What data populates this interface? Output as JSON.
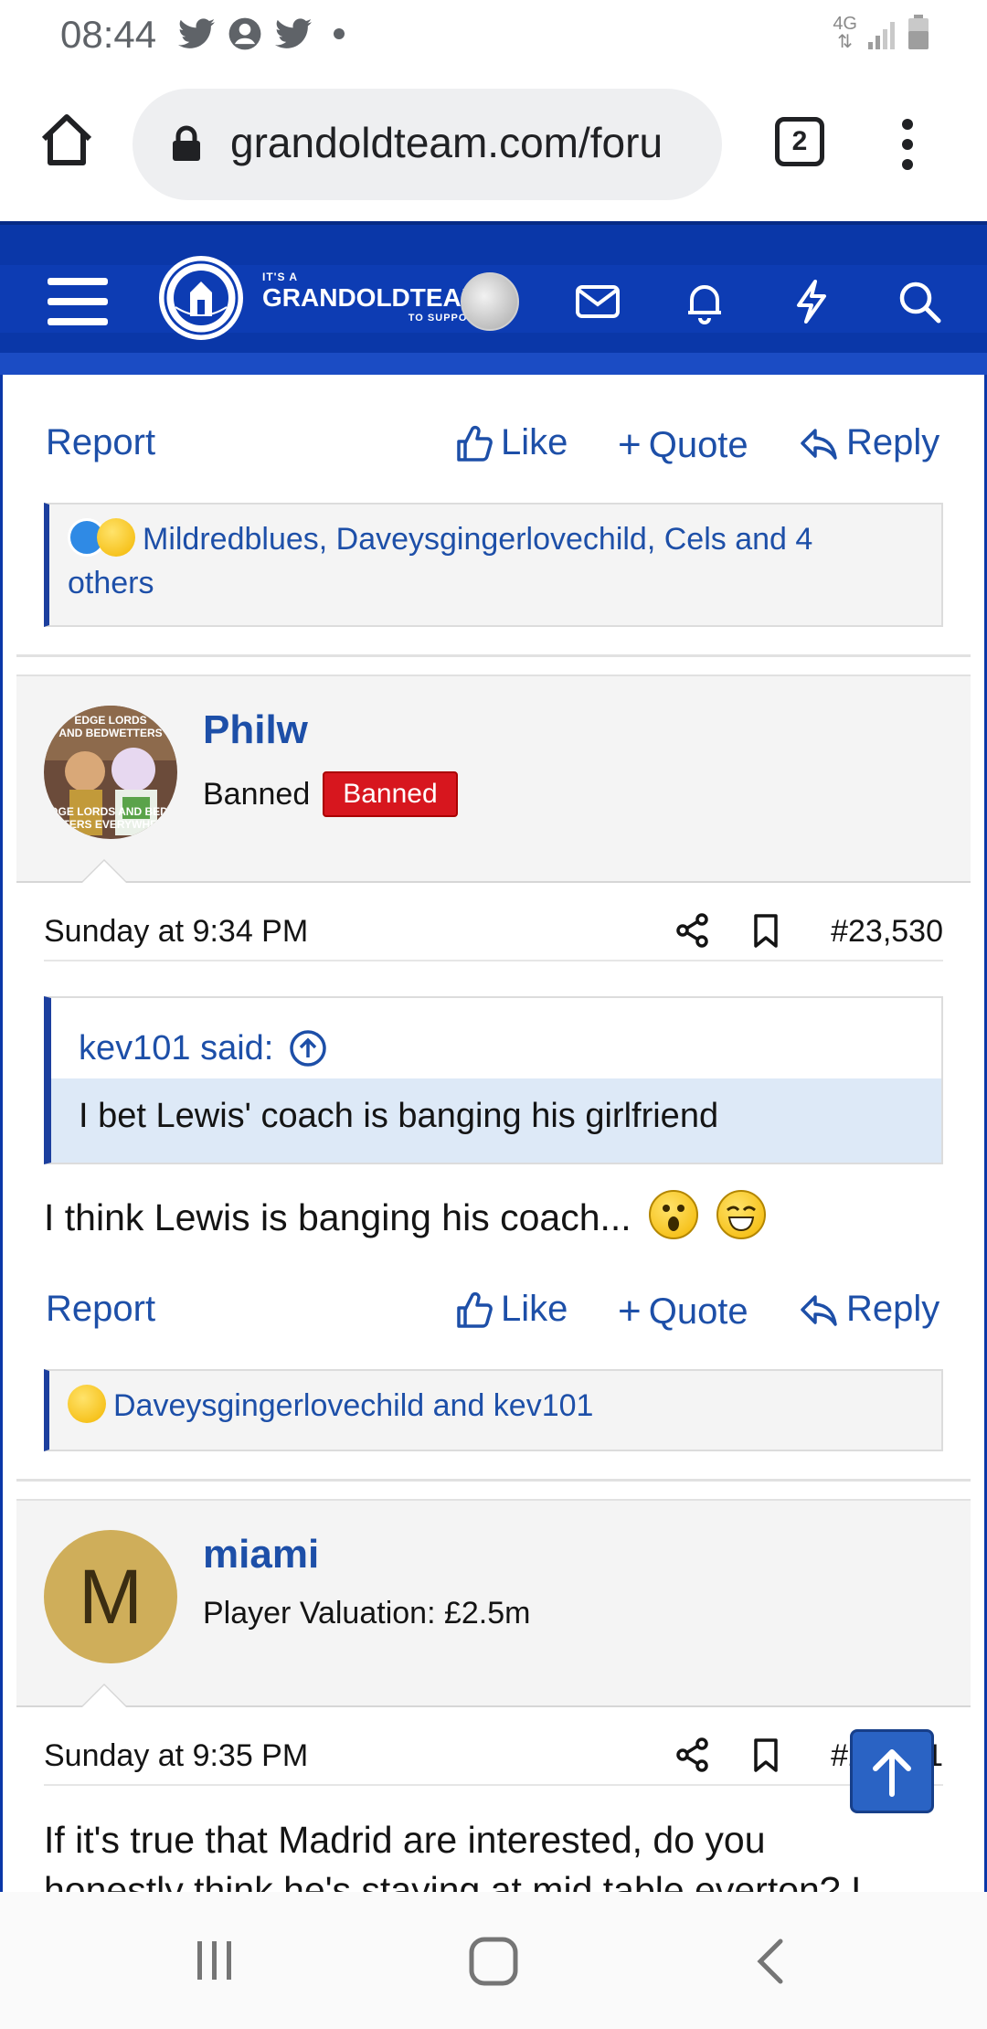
{
  "status_bar": {
    "time": "08:44",
    "network": "4G"
  },
  "browser": {
    "url": "grandoldteam.com/foru",
    "tab_count": "2"
  },
  "site_header": {
    "logo_top": "IT'S A",
    "logo_main": "GRANDOLDTEAM",
    "logo_sub": "TO SUPPORT"
  },
  "actions": {
    "report": "Report",
    "like": "Like",
    "quote": "Quote",
    "reply": "Reply"
  },
  "post_prev": {
    "reactions_line1": "Mildredblues, Daveysgingerlovechild, Cels and 4",
    "reactions_line2": "others"
  },
  "post1": {
    "username": "Philw",
    "user_title": "Banned",
    "badge": "Banned",
    "avatar_caption_top": "EDGE LORDS AND BEDWETTERS",
    "avatar_caption_bottom": "EDGE LORDS AND BEDWETTERS EVERYWHERE",
    "date": "Sunday at 9:34 PM",
    "post_number": "#23,530",
    "quote_author": "kev101 said:",
    "quote_text": "I bet Lewis' coach is banging his girlfriend",
    "message": "I think Lewis is banging his coach...",
    "reactions": "Daveysgingerlovechild and kev101"
  },
  "post2": {
    "username": "miami",
    "avatar_letter": "M",
    "user_title": "Player Valuation: £2.5m",
    "date": "Sunday at 9:35 PM",
    "post_number": "#23,531",
    "message_line1": "If it's true that Madrid are interested, do you",
    "message_line2": "honestly think he's staying at mid table everton? I"
  },
  "colors": {
    "header_blue": "#0a37a8",
    "link_blue": "#1d4fa8",
    "banned_red": "#d7161e",
    "avatar_m": "#cfae5a"
  }
}
